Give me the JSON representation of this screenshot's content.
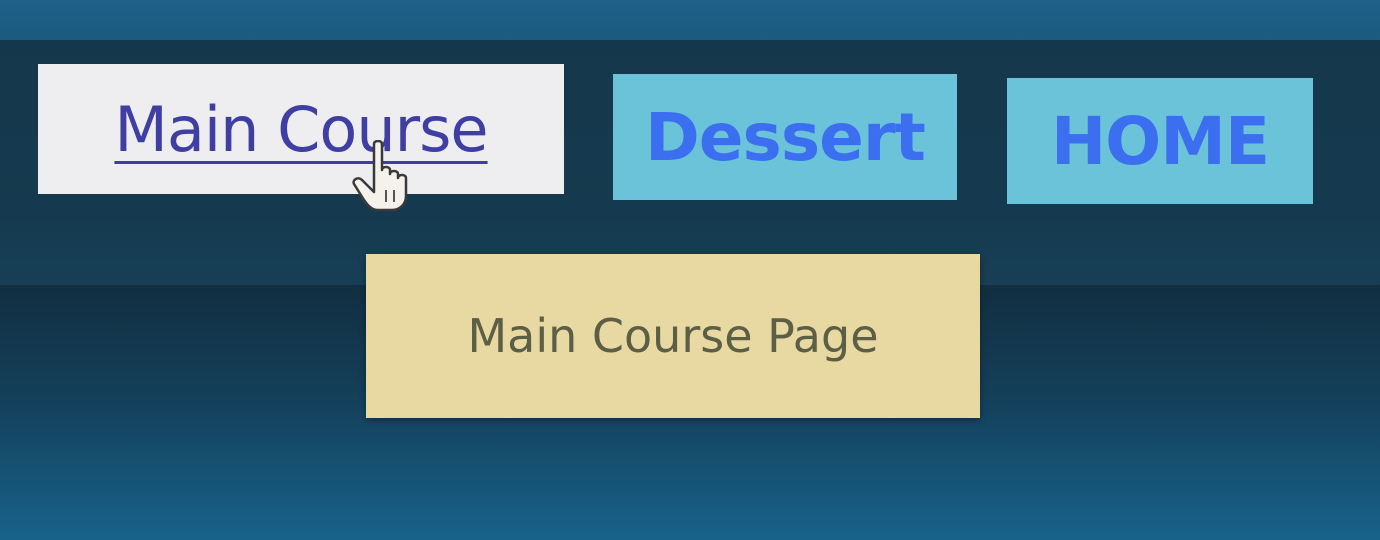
{
  "nav": {
    "items": [
      {
        "label": "Main Course",
        "state": "active-hover"
      },
      {
        "label": "Dessert",
        "state": "inactive"
      },
      {
        "label": "HOME",
        "state": "inactive"
      }
    ]
  },
  "tooltip": {
    "text": "Main Course Page"
  },
  "cursor": {
    "icon": "hand-pointer-icon"
  },
  "colors": {
    "background": "#15374b",
    "active_bg": "#eeeef0",
    "active_text": "#3f3fa3",
    "inactive_bg": "#6bc3d9",
    "inactive_text": "#3c6ff0",
    "tooltip_bg": "#e7d9a1",
    "tooltip_text": "#5d5e46"
  }
}
